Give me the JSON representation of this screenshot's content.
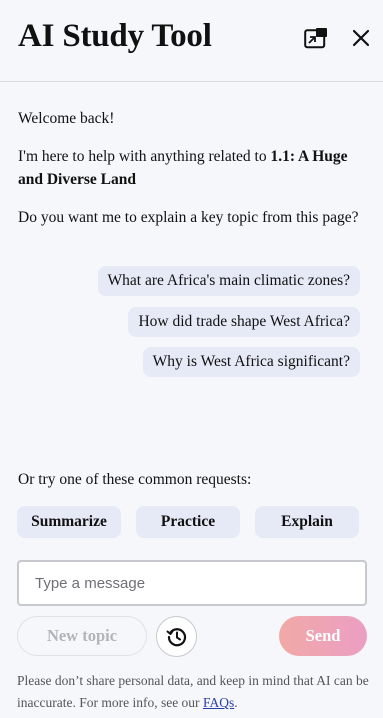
{
  "header": {
    "title": "AI Study Tool",
    "popout_icon": "popout-window-icon",
    "close_icon": "close-icon"
  },
  "chat": {
    "welcome": "Welcome back!",
    "intro_prefix": "I'm here to help with anything related to ",
    "intro_bold": "1.1: A Huge and Diverse Land",
    "question": "Do you want me to explain a key topic from this page?",
    "suggestions": [
      "What are Africa's main climatic zones?",
      "How did trade shape West Africa?",
      "Why is West Africa significant?"
    ],
    "common_prompt": "Or try one of these common requests:",
    "chips": [
      "Summarize",
      "Practice",
      "Explain"
    ]
  },
  "composer": {
    "placeholder": "Type a message",
    "new_topic_label": "New topic",
    "history_icon": "history-icon",
    "send_label": "Send"
  },
  "footer": {
    "disclaimer_text": "Please don’t share personal data, and keep in mind that AI can be inaccurate. For more info, see our ",
    "faq_link": "FAQs",
    "disclaimer_end": "."
  },
  "colors": {
    "background": "#f6f7fb",
    "chip_bg": "#e6eaf6",
    "send_gradient_start": "#f0a9a7",
    "send_gradient_end": "#ec9ec3",
    "link": "#2b3fa8"
  }
}
